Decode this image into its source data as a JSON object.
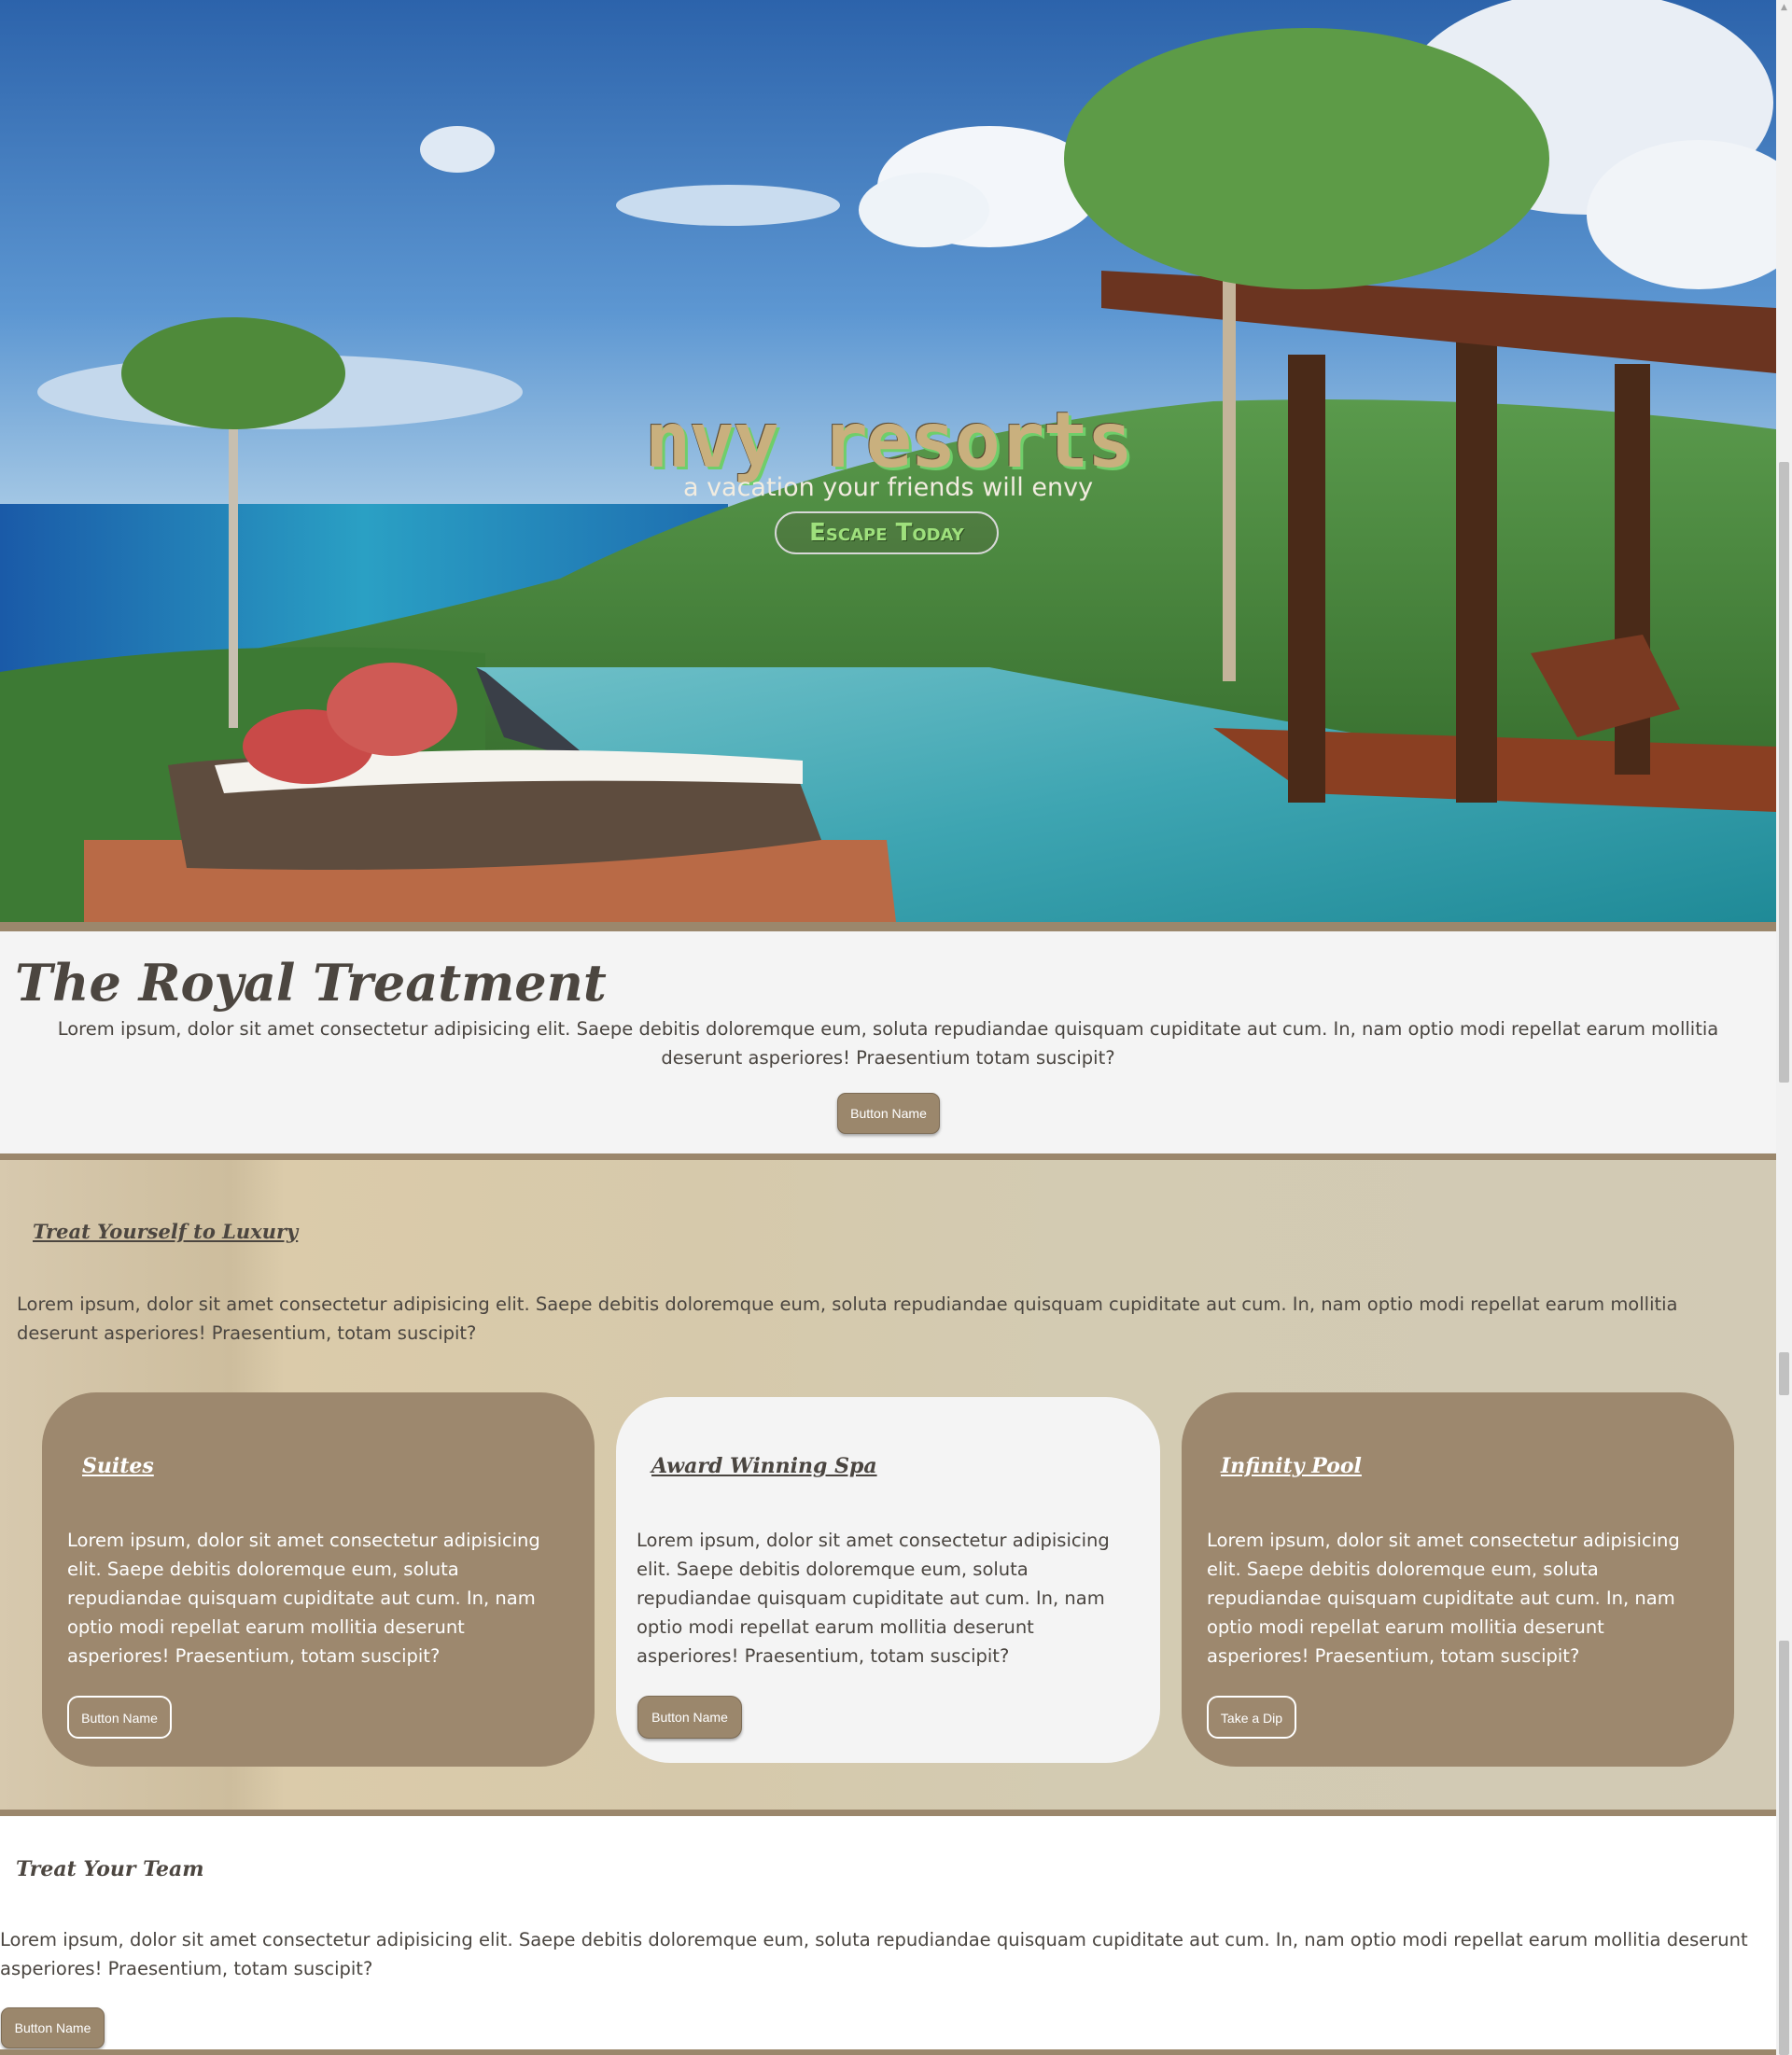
{
  "hero": {
    "title": "nvy resorts",
    "subtitle": "a vacation your friends will envy",
    "cta_label": "Escape Today"
  },
  "royal": {
    "title": "The Royal Treatment",
    "text": "Lorem ipsum, dolor sit amet consectetur adipisicing elit. Saepe debitis doloremque eum, soluta repudiandae quisquam cupiditate aut cum. In, nam optio modi repellat earum mollitia deserunt asperiores! Praesentium totam suscipit?",
    "button_label": "Button Name"
  },
  "luxury": {
    "title": "Treat Yourself to Luxury",
    "text": "Lorem ipsum, dolor sit amet consectetur adipisicing elit. Saepe debitis doloremque eum, soluta repudiandae quisquam cupiditate aut cum. In, nam optio modi repellat earum mollitia deserunt asperiores! Praesentium, totam suscipit?",
    "cards": [
      {
        "title": "Suites",
        "text": "Lorem ipsum, dolor sit amet consectetur adipisicing elit. Saepe debitis doloremque eum, soluta repudiandae quisquam cupiditate aut cum. In, nam optio modi repellat earum mollitia deserunt asperiores! Praesentium, totam suscipit?",
        "button_label": "Button Name"
      },
      {
        "title": "Award Winning Spa",
        "text": "Lorem ipsum, dolor sit amet consectetur adipisicing elit. Saepe debitis doloremque eum, soluta repudiandae quisquam cupiditate aut cum. In, nam optio modi repellat earum mollitia deserunt asperiores! Praesentium, totam suscipit?",
        "button_label": "Button Name"
      },
      {
        "title": "Infinity Pool",
        "text": "Lorem ipsum, dolor sit amet consectetur adipisicing elit. Saepe debitis doloremque eum, soluta repudiandae quisquam cupiditate aut cum. In, nam optio modi repellat earum mollitia deserunt asperiores! Praesentium, totam suscipit?",
        "button_label": "Take a Dip"
      }
    ]
  },
  "team": {
    "title": "Treat Your Team",
    "text": "Lorem ipsum, dolor sit amet consectetur adipisicing elit. Saepe debitis doloremque eum, soluta repudiandae quisquam cupiditate aut cum. In, nam optio modi repellat earum mollitia deserunt asperiores! Praesentium, totam suscipit?",
    "button_label": "Button Name"
  },
  "colors": {
    "accent_tan": "#9b876c",
    "light_bg": "#f4f4f4",
    "text_dark": "#4a4540",
    "hero_title_green": "#6fce6a"
  },
  "icons": {
    "scroll_up": "scroll-up-arrow-icon",
    "scroll_down": "scroll-down-arrow-icon"
  }
}
